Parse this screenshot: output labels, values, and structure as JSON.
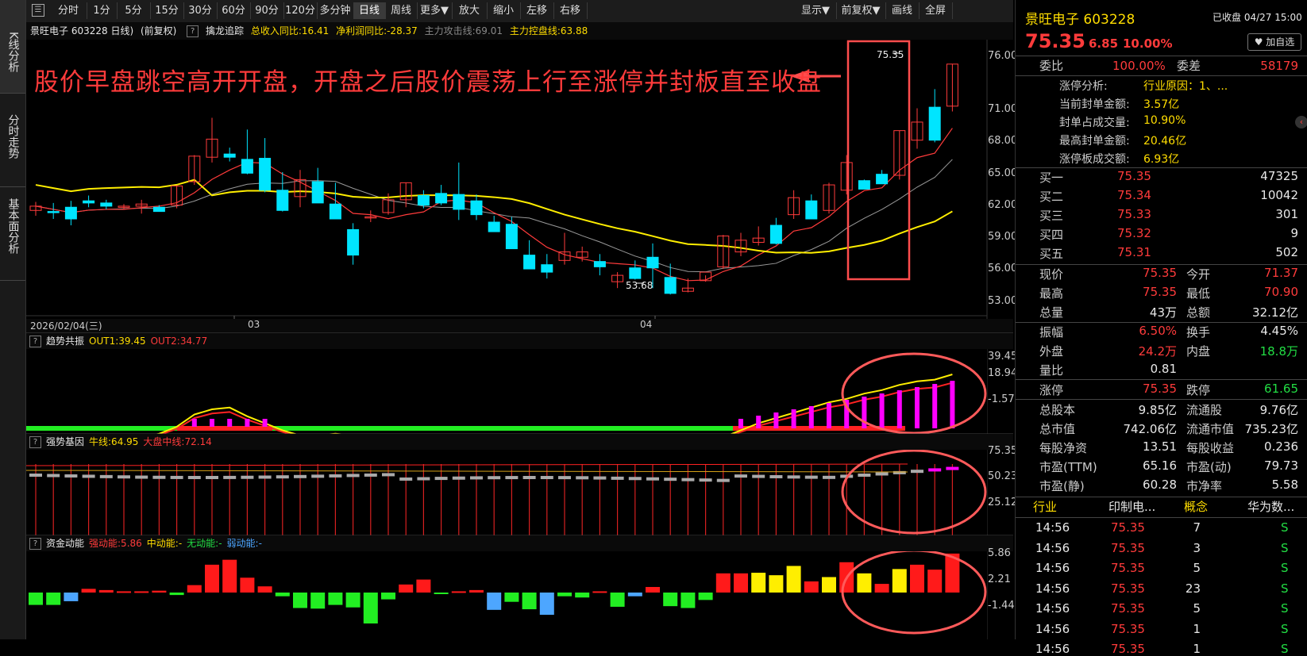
{
  "left_tabs": [
    {
      "label": "K线分析",
      "active": true
    },
    {
      "label": "分时走势",
      "active": false
    },
    {
      "label": "基本面分析",
      "active": false
    }
  ],
  "toolbar": {
    "menu_icon": "box-icon",
    "buttons": [
      "分时",
      "1分",
      "5分",
      "15分",
      "30分",
      "60分",
      "90分",
      "120分",
      "多分钟",
      "日线",
      "周线",
      "更多▼",
      "放大",
      "缩小",
      "左移",
      "右移",
      "显示▼",
      "前复权▼",
      "画线",
      "全屏"
    ],
    "selected": "日线"
  },
  "info_bar": {
    "stock": "景旺电子 603228 日线)",
    "adjust": "(前复权)",
    "indicator_name": "擒龙追踪",
    "income": "总收入同比:16.41",
    "profit": "净利润同比:-28.37",
    "attack": "主力攻击线:69.01",
    "control": "主力控盘线:63.88"
  },
  "annotation": "股价早盘跳空高开开盘，开盘之后股价震荡上行至涨停并封板直至收盘",
  "price_axis": [
    "76.00",
    "71.00",
    "68.00",
    "65.00",
    "62.00",
    "59.00",
    "56.00",
    "53.00"
  ],
  "date_axis": [
    "2026/02/04(三)",
    "03",
    "04"
  ],
  "high_marker": "75.35",
  "low_marker": "53.68",
  "panel_trend": {
    "name": "趋势共振",
    "out1": "OUT1:39.45",
    "out2": "OUT2:34.77",
    "axis": [
      "39.45",
      "18.94",
      "-1.57"
    ]
  },
  "panel_gene": {
    "name": "强势基因",
    "bull": "牛线:64.95",
    "market": "大盘中线:72.14",
    "axis": [
      "75.35",
      "50.23",
      "25.12"
    ]
  },
  "panel_money": {
    "name": "资金动能",
    "strong": "强动能:5.86",
    "mid": "中动能:-",
    "none": "无动能:-",
    "weak": "弱动能:-",
    "axis": [
      "5.86",
      "2.21",
      "-1.44"
    ]
  },
  "chart_data": {
    "type": "candlestick",
    "title": "景旺电子 603228 日线",
    "ohlc": [
      [
        61.6,
        62.4,
        61.1,
        62.0
      ],
      [
        61.5,
        62.3,
        60.8,
        61.4
      ],
      [
        61.9,
        62.5,
        60.2,
        60.8
      ],
      [
        62.5,
        63.0,
        61.9,
        62.3
      ],
      [
        62.3,
        62.6,
        61.7,
        62.0
      ],
      [
        61.9,
        62.2,
        61.7,
        62.0
      ],
      [
        62.0,
        62.6,
        61.3,
        62.2
      ],
      [
        61.9,
        62.1,
        61.5,
        61.5
      ],
      [
        62.1,
        63.9,
        61.8,
        63.9
      ],
      [
        64.3,
        66.8,
        64.0,
        66.7
      ],
      [
        66.6,
        70.3,
        66.1,
        68.3
      ],
      [
        66.9,
        67.5,
        66.2,
        66.6
      ],
      [
        66.4,
        69.2,
        65.0,
        65.1
      ],
      [
        66.5,
        68.4,
        63.3,
        63.5
      ],
      [
        63.5,
        65.2,
        61.5,
        61.6
      ],
      [
        62.9,
        65.4,
        61.9,
        64.5
      ],
      [
        64.3,
        65.6,
        62.3,
        62.3
      ],
      [
        62.2,
        64.2,
        60.8,
        60.8
      ],
      [
        59.8,
        60.4,
        56.5,
        57.4
      ],
      [
        61.0,
        61.6,
        60.5,
        61.0
      ],
      [
        61.4,
        63.2,
        61.2,
        62.6
      ],
      [
        62.6,
        64.2,
        61.9,
        64.2
      ],
      [
        63.0,
        63.5,
        61.8,
        62.1
      ],
      [
        63.2,
        64.0,
        62.1,
        62.3
      ],
      [
        63.1,
        66.1,
        60.7,
        61.7
      ],
      [
        62.5,
        63.1,
        60.7,
        61.2
      ],
      [
        60.5,
        61.1,
        59.9,
        59.6
      ],
      [
        60.3,
        61.0,
        58.0,
        58.0
      ],
      [
        57.4,
        58.8,
        56.2,
        56.1
      ],
      [
        56.5,
        57.5,
        55.2,
        55.8
      ],
      [
        56.9,
        59.5,
        56.5,
        57.7
      ],
      [
        57.2,
        58.2,
        56.8,
        57.7
      ],
      [
        56.8,
        57.5,
        55.5,
        56.3
      ],
      [
        54.9,
        55.8,
        54.3,
        55.5
      ],
      [
        56.2,
        56.9,
        55.1,
        55.2
      ],
      [
        57.2,
        58.5,
        54.3,
        56.2
      ],
      [
        55.3,
        56.6,
        53.7,
        53.8
      ],
      [
        54.0,
        55.2,
        53.9,
        54.3
      ],
      [
        55.0,
        55.5,
        54.9,
        55.8
      ],
      [
        56.3,
        59.3,
        56.1,
        59.2
      ],
      [
        57.7,
        59.5,
        57.3,
        58.8
      ],
      [
        58.6,
        60.1,
        58.3,
        59.0
      ],
      [
        60.2,
        60.9,
        58.4,
        58.5
      ],
      [
        61.2,
        63.5,
        60.8,
        62.8
      ],
      [
        62.5,
        63.1,
        60.8,
        60.8
      ],
      [
        61.6,
        64.2,
        61.3,
        64.0
      ],
      [
        63.5,
        66.8,
        63.1,
        66.1
      ],
      [
        64.4,
        64.5,
        63.6,
        63.6
      ],
      [
        65.0,
        65.4,
        64.1,
        64.1
      ],
      [
        64.9,
        69.1,
        64.5,
        69.1
      ],
      [
        68.2,
        71.2,
        67.4,
        69.9
      ],
      [
        71.3,
        73.0,
        68.0,
        68.2
      ],
      [
        71.4,
        75.35,
        70.9,
        75.35
      ]
    ],
    "colors": {
      "up": "#ff3b3b",
      "down": "#00e5ff",
      "ma5": "#ff3b3b",
      "ma20": "#ffee00",
      "ma10": "#999999"
    },
    "ylim": [
      53,
      76
    ]
  },
  "right_panel": {
    "stock_name": "景旺电子 603228",
    "status": "已收盘 04/27 15:00",
    "price": "75.35",
    "change": "6.85",
    "change_pct": "10.00%",
    "fav_button": "♥ 加自选",
    "weibi_label": "委比",
    "weibi_value": "100.00%",
    "weicha_label": "委差",
    "weicha_value": "58179",
    "limit_analysis": [
      {
        "k": "涨停分析:",
        "v": "行业原因：1、..."
      },
      {
        "k": "当前封单金额:",
        "v": "3.57亿"
      },
      {
        "k": "封单占成交量:",
        "v": "10.90%"
      },
      {
        "k": "最高封单金额:",
        "v": "20.46亿"
      },
      {
        "k": "涨停板成交额:",
        "v": "6.93亿"
      }
    ],
    "bids": [
      {
        "k": "买一",
        "p": "75.35",
        "q": "47325"
      },
      {
        "k": "买二",
        "p": "75.34",
        "q": "10042"
      },
      {
        "k": "买三",
        "p": "75.33",
        "q": "301"
      },
      {
        "k": "买四",
        "p": "75.32",
        "q": "9"
      },
      {
        "k": "买五",
        "p": "75.31",
        "q": "502"
      }
    ],
    "quote_rows": [
      [
        {
          "k": "现价",
          "v": "75.35",
          "c": "red"
        },
        {
          "k": "今开",
          "v": "71.37",
          "c": "red"
        }
      ],
      [
        {
          "k": "最高",
          "v": "75.35",
          "c": "red"
        },
        {
          "k": "最低",
          "v": "70.90",
          "c": "red"
        }
      ],
      [
        {
          "k": "总量",
          "v": "43万",
          "c": "white"
        },
        {
          "k": "总额",
          "v": "32.12亿",
          "c": "white"
        }
      ]
    ],
    "quote_rows2": [
      [
        {
          "k": "振幅",
          "v": "6.50%",
          "c": "red"
        },
        {
          "k": "换手",
          "v": "4.45%",
          "c": "white"
        }
      ],
      [
        {
          "k": "外盘",
          "v": "24.2万",
          "c": "red"
        },
        {
          "k": "内盘",
          "v": "18.8万",
          "c": "green"
        }
      ],
      [
        {
          "k": "量比",
          "v": "0.81",
          "c": "white"
        },
        {
          "k": "",
          "v": "",
          "c": "white"
        }
      ]
    ],
    "limit_rows": [
      [
        {
          "k": "涨停",
          "v": "75.35",
          "c": "red"
        },
        {
          "k": "跌停",
          "v": "61.65",
          "c": "green"
        }
      ]
    ],
    "fund_rows": [
      [
        {
          "k": "总股本",
          "v": "9.85亿"
        },
        {
          "k": "流通股",
          "v": "9.76亿"
        }
      ],
      [
        {
          "k": "总市值",
          "v": "742.06亿"
        },
        {
          "k": "流通市值",
          "v": "735.23亿"
        }
      ],
      [
        {
          "k": "每股净资",
          "v": "13.51"
        },
        {
          "k": "每股收益",
          "v": "0.236"
        }
      ],
      [
        {
          "k": "市盈(TTM)",
          "v": "65.16"
        },
        {
          "k": "市盈(动)",
          "v": "79.73"
        }
      ],
      [
        {
          "k": "市盈(静)",
          "v": "60.28"
        },
        {
          "k": "市净率",
          "v": "5.58"
        }
      ]
    ],
    "industry": [
      {
        "k": "行业",
        "v": "印制电..."
      },
      {
        "k": "概念",
        "v": "华为数..."
      }
    ],
    "ticks": [
      {
        "t": "14:56",
        "p": "75.35",
        "q": "7",
        "s": "S"
      },
      {
        "t": "14:56",
        "p": "75.35",
        "q": "3",
        "s": "S"
      },
      {
        "t": "14:56",
        "p": "75.35",
        "q": "5",
        "s": "S"
      },
      {
        "t": "14:56",
        "p": "75.35",
        "q": "23",
        "s": "S"
      },
      {
        "t": "14:56",
        "p": "75.35",
        "q": "5",
        "s": "S"
      },
      {
        "t": "14:56",
        "p": "75.35",
        "q": "1",
        "s": "S"
      },
      {
        "t": "14:56",
        "p": "75.35",
        "q": "1",
        "s": "S"
      }
    ]
  }
}
